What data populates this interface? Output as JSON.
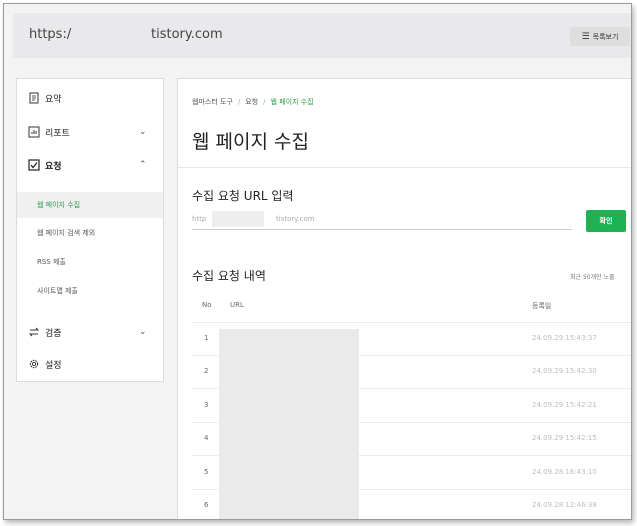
{
  "topbar": {
    "url_prefix": "https:/",
    "url_suffix": "tistory.com",
    "list_button_label": "목록보기",
    "list_button_icon": "list-icon"
  },
  "sidebar": {
    "items": [
      {
        "label": "요약",
        "icon": "document-icon"
      },
      {
        "label": "리포트",
        "icon": "chart-icon",
        "chevron": "⌄"
      },
      {
        "label": "요청",
        "icon": "checkbox-icon",
        "chevron": "⌃"
      },
      {
        "label": "검증",
        "icon": "swap-icon",
        "chevron": "⌄"
      },
      {
        "label": "설정",
        "icon": "gear-icon"
      }
    ],
    "subitems": [
      {
        "label": "웹 페이지 수집",
        "active": true
      },
      {
        "label": "웹 페이지 검색 제외"
      },
      {
        "label": "RSS 제출"
      },
      {
        "label": "사이트맵 제출"
      }
    ]
  },
  "main": {
    "breadcrumb": [
      "웹마스터 도구",
      "요청",
      "웹 페이지 수집"
    ],
    "title": "웹 페이지 수집",
    "url_section_title": "수집 요청 URL 입력",
    "url_input_prefix": "http",
    "url_input_suffix": "tistory.com",
    "confirm_label": "확인",
    "history_title": "수집 요청 내역",
    "recent_note": "최근 50개만 노출",
    "columns": [
      "No",
      "URL",
      "등록일"
    ],
    "rows": [
      {
        "no": "1",
        "date": "24.09.29 15:43:37"
      },
      {
        "no": "2",
        "date": "24.09.29 15:42:30"
      },
      {
        "no": "3",
        "date": "24.09.29 15:42:21"
      },
      {
        "no": "4",
        "date": "24.09.29 15:42:15"
      },
      {
        "no": "5",
        "date": "24.09.28 16:43:10"
      },
      {
        "no": "6",
        "date": "24.09.28 12:46:38"
      }
    ]
  },
  "colors": {
    "accent": "#1fb255",
    "active_text": "#2a9a4a"
  }
}
